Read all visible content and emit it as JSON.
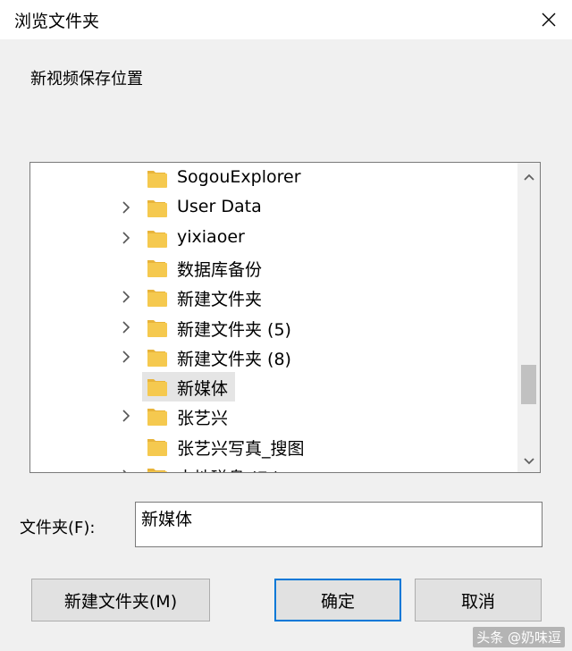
{
  "window": {
    "title": "浏览文件夹"
  },
  "prompt": "新视频保存位置",
  "tree": {
    "items": [
      {
        "label": "SogouExplorer",
        "expandable": false,
        "selected": false
      },
      {
        "label": "User Data",
        "expandable": true,
        "selected": false
      },
      {
        "label": "yixiaoer",
        "expandable": true,
        "selected": false
      },
      {
        "label": "数据库备份",
        "expandable": false,
        "selected": false
      },
      {
        "label": "新建文件夹",
        "expandable": true,
        "selected": false
      },
      {
        "label": "新建文件夹 (5)",
        "expandable": true,
        "selected": false
      },
      {
        "label": "新建文件夹 (8)",
        "expandable": true,
        "selected": false
      },
      {
        "label": "新媒体",
        "expandable": false,
        "selected": true
      },
      {
        "label": "张艺兴",
        "expandable": true,
        "selected": false
      },
      {
        "label": "张艺兴写真_搜图",
        "expandable": false,
        "selected": false
      },
      {
        "label": "本地磁盘 (E:)",
        "expandable": true,
        "selected": false
      }
    ]
  },
  "folder": {
    "label": "文件夹(F):",
    "value": "新媒体"
  },
  "buttons": {
    "new_folder": "新建文件夹(M)",
    "ok": "确定",
    "cancel": "取消"
  },
  "watermark": "头条 @奶味逗",
  "colors": {
    "folder": "#f5c94f",
    "accent": "#0078d7"
  }
}
